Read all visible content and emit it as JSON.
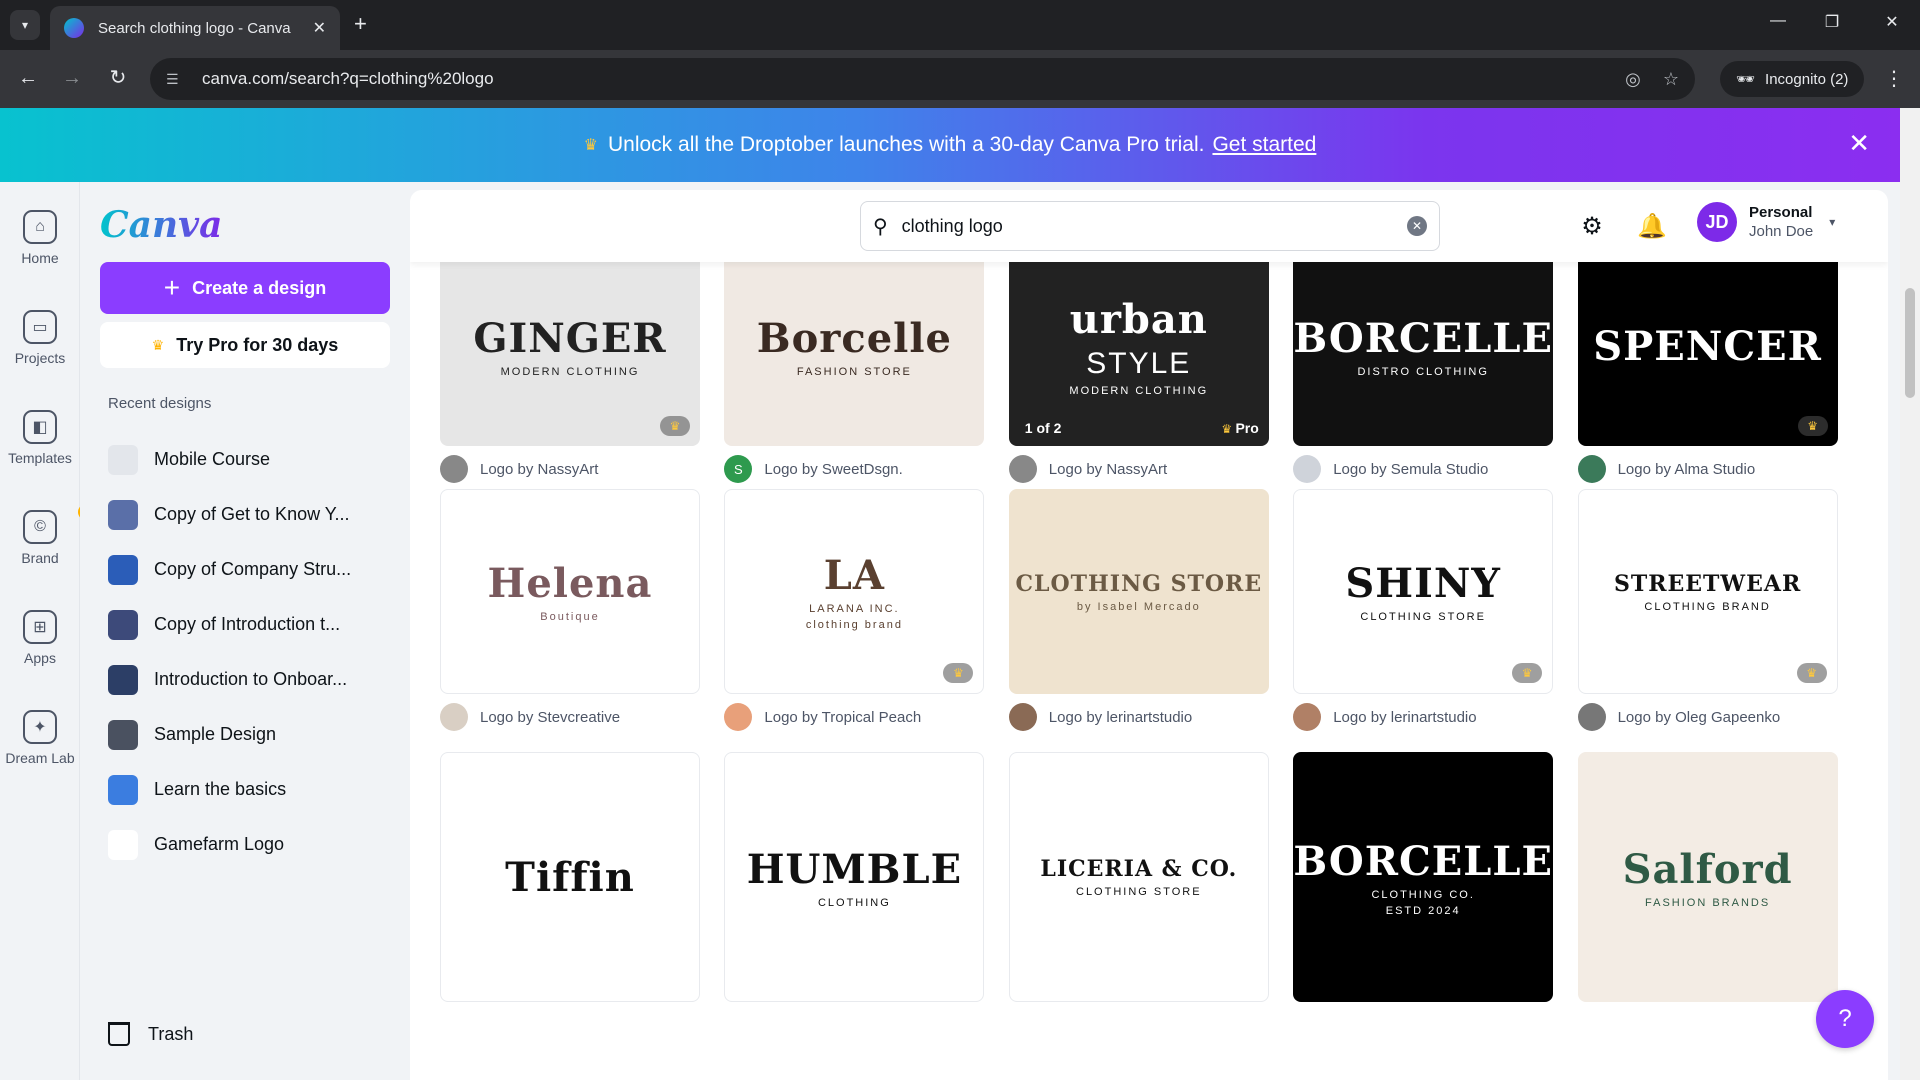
{
  "browser": {
    "tab_title": "Search clothing logo - Canva",
    "url": "canva.com/search?q=clothing%20logo",
    "incognito_label": "Incognito (2)"
  },
  "banner": {
    "text": "Unlock all the Droptober launches with a 30-day Canva Pro trial.",
    "link": "Get started"
  },
  "rail": {
    "items": [
      {
        "label": "Home",
        "icon": "home-icon"
      },
      {
        "label": "Projects",
        "icon": "folder-icon"
      },
      {
        "label": "Templates",
        "icon": "templates-icon"
      },
      {
        "label": "Brand",
        "icon": "brand-icon"
      },
      {
        "label": "Apps",
        "icon": "apps-icon"
      },
      {
        "label": "Dream Lab",
        "icon": "dream-lab-icon"
      }
    ]
  },
  "sidebar": {
    "logo": "Canva",
    "create_label": "Create a design",
    "trypro_label": "Try Pro for 30 days",
    "recent_heading": "Recent designs",
    "recent": [
      {
        "label": "Mobile Course",
        "color": "#e3e6eb"
      },
      {
        "label": "Copy of Get to Know Y...",
        "color": "#5a6fa8"
      },
      {
        "label": "Copy of Company Stru...",
        "color": "#2b5db8"
      },
      {
        "label": "Copy of Introduction t...",
        "color": "#3d4a7a"
      },
      {
        "label": "Introduction to Onboar...",
        "color": "#2c3e66"
      },
      {
        "label": "Sample Design",
        "color": "#4a5160"
      },
      {
        "label": "Learn the basics",
        "color": "#3b7de0"
      },
      {
        "label": "Gamefarm Logo",
        "color": "#ffffff"
      }
    ],
    "trash_label": "Trash"
  },
  "header": {
    "search_value": "clothing logo",
    "plan": "Personal",
    "user": "John Doe",
    "initials": "JD"
  },
  "results": [
    {
      "credit": "Logo by NassyArt",
      "art": "GINGER",
      "sub": "MODERN CLOTHING",
      "bg": "#e6e6e6",
      "fg": "#222222",
      "pro": true,
      "avatar": "#888888"
    },
    {
      "credit": "Logo by SweetDsgn.",
      "art": "Borcelle",
      "sub": "FASHION STORE",
      "bg": "#f0e9e3",
      "fg": "#3a2a22",
      "pro": false,
      "avatar": "#2e9a4e",
      "avatar_letter": "S"
    },
    {
      "credit": "Logo by NassyArt",
      "art": "urban",
      "art2": "STYLE",
      "sub": "MODERN CLOTHING",
      "bg": "#222222",
      "fg": "#ffffff",
      "pro": false,
      "pro_text": "Pro",
      "page": "1 of 2",
      "avatar": "#888888"
    },
    {
      "credit": "Logo by Semula Studio",
      "art": "BORCELLE",
      "sub": "DISTRO CLOTHING",
      "bg": "#111111",
      "fg": "#ffffff",
      "pro": false,
      "avatar": "#cfd3da"
    },
    {
      "credit": "Logo by Alma Studio",
      "art": "SPENCER",
      "bg": "#000000",
      "fg": "#ffffff",
      "pro": true,
      "avatar": "#3b7a5a"
    },
    {
      "credit": "Logo by Stevcreative",
      "art": "Helena",
      "sub": "Boutique",
      "bg": "#ffffff",
      "fg": "#7a5a5e",
      "pro": false,
      "avatar": "#d9cfc4"
    },
    {
      "credit": "Logo by Tropical Peach",
      "art": "LA",
      "sub": "LARANA INC.",
      "sub2": "clothing brand",
      "bg": "#ffffff",
      "fg": "#5a4030",
      "pro": true,
      "avatar": "#e8a07a"
    },
    {
      "credit": "Logo by lerinartstudio",
      "art": "CLOTHING STORE",
      "sub": "by Isabel Mercado",
      "bg": "#efe3cf",
      "fg": "#6b5a44",
      "pro": false,
      "avatar": "#8a6a55"
    },
    {
      "credit": "Logo by lerinartstudio",
      "art": "SHINY",
      "sub": "CLOTHING STORE",
      "bg": "#ffffff",
      "fg": "#111111",
      "pro": true,
      "avatar": "#b08066"
    },
    {
      "credit": "Logo by Oleg Gapeenko",
      "art": "STREETWEAR",
      "sub": "CLOTHING BRAND",
      "bg": "#ffffff",
      "fg": "#111111",
      "pro": true,
      "avatar": "#777777"
    },
    {
      "art": "Tiffin",
      "bg": "#ffffff",
      "fg": "#111111"
    },
    {
      "art": "HUMBLE",
      "sub": "CLOTHING",
      "bg": "#ffffff",
      "fg": "#111111"
    },
    {
      "art": "LICERIA & CO.",
      "sub": "CLOTHING STORE",
      "bg": "#ffffff",
      "fg": "#111111"
    },
    {
      "art": "BORCELLE",
      "sub": "CLOTHING CO.",
      "sub2": "ESTD 2024",
      "bg": "#000000",
      "fg": "#ffffff"
    },
    {
      "art": "Salford",
      "sub": "FASHION BRANDS",
      "bg": "#f3ece4",
      "fg": "#2f5a45"
    }
  ],
  "colors": {
    "accent": "#8b3dff",
    "banner_start": "#08c2cf",
    "banner_end": "#8b2ef0"
  }
}
